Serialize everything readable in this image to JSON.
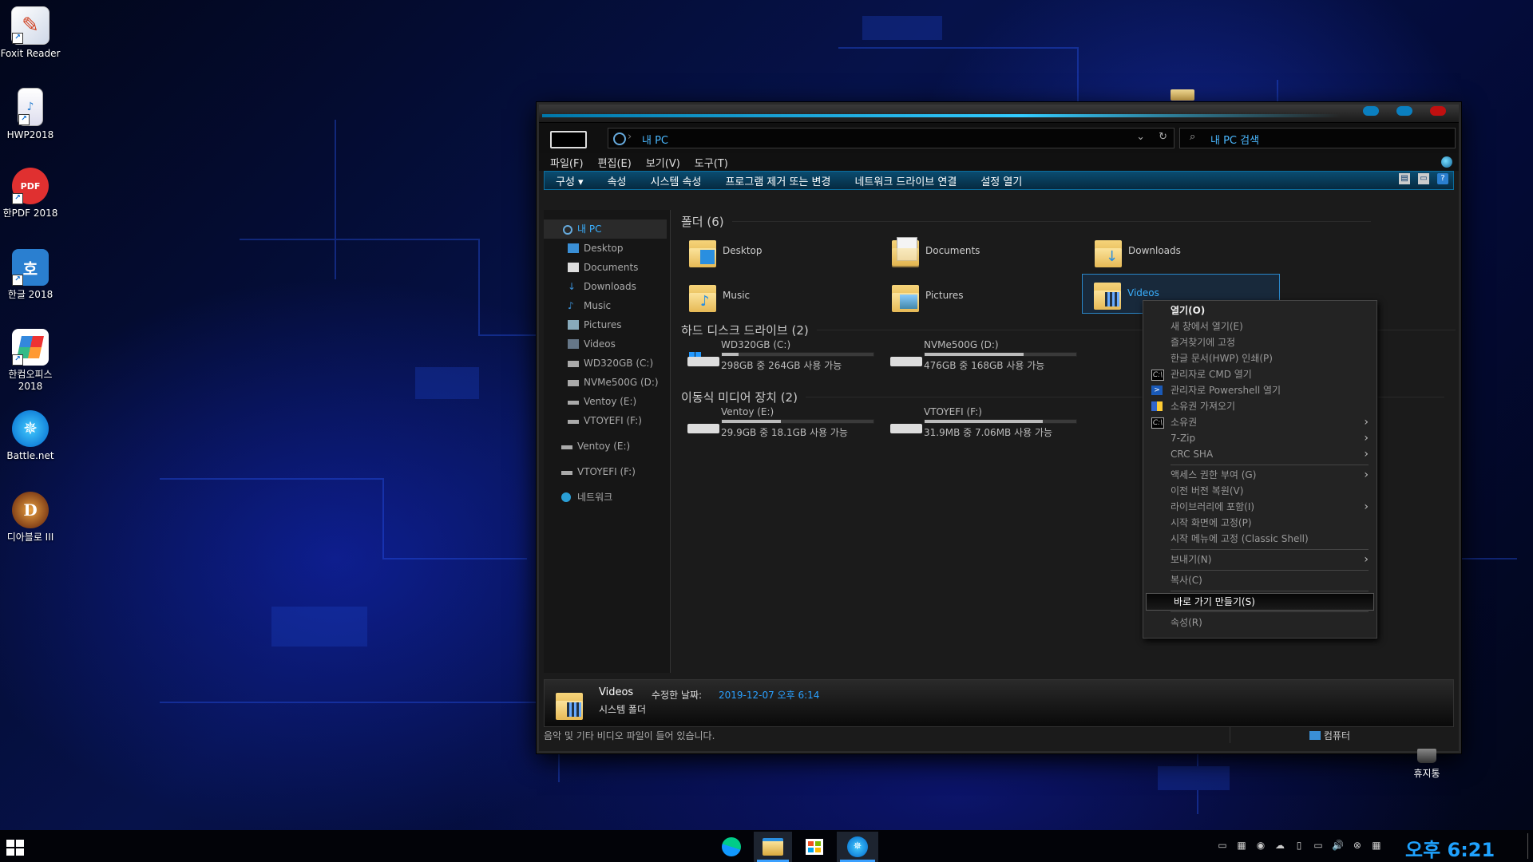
{
  "desktop": {
    "icons": [
      {
        "label": "Foxit Reader",
        "icon": "foxit-reader-icon",
        "color": "#f0f0f0"
      },
      {
        "label": "HWP2018",
        "icon": "hwp-document-icon",
        "color": "#5aa0e0"
      },
      {
        "label": "한PDF 2018",
        "icon": "hanpdf-icon",
        "color": "#e03030"
      },
      {
        "label": "한글 2018",
        "icon": "hangul-icon",
        "color": "#2a7fd0"
      },
      {
        "label": "한컴오피스 2018",
        "icon": "hancom-office-icon",
        "color": "#ffffff"
      },
      {
        "label": "Battle.net",
        "icon": "battlenet-icon",
        "color": "#1a8fff"
      },
      {
        "label": "디아블로 III",
        "icon": "diablo-icon",
        "color": "#7a2a10"
      }
    ],
    "icon_glyphs": {
      "hangul": "호",
      "pdf": "PDF",
      "diablo": "D"
    },
    "recycle_bin": "휴지통"
  },
  "explorer": {
    "address": {
      "label": "내 PC",
      "separator": "›",
      "dropdown": "⌄",
      "refresh": "↻"
    },
    "search_placeholder": "내 PC 검색",
    "menu": [
      "파일(F)",
      "편집(E)",
      "보기(V)",
      "도구(T)"
    ],
    "commands": [
      "구성 ▾",
      "속성",
      "시스템 속성",
      "프로그램 제거 또는 변경",
      "네트워크 드라이브 연결",
      "설정 열기"
    ],
    "nav": {
      "root": "내 PC",
      "children": [
        "Desktop",
        "Documents",
        "Downloads",
        "Music",
        "Pictures",
        "Videos",
        "WD320GB (C:)",
        "NVMe500G (D:)",
        "Ventoy (E:)",
        "VTOYEFI (F:)"
      ],
      "extra": [
        "Ventoy (E:)",
        "VTOYEFI (F:)",
        "네트워크"
      ]
    },
    "groups": {
      "folders": "폴더 (6)",
      "hdd": "하드 디스크 드라이브 (2)",
      "removable": "이동식 미디어 장치 (2)"
    },
    "folders": [
      "Desktop",
      "Documents",
      "Downloads",
      "Music",
      "Pictures",
      "Videos"
    ],
    "drives": [
      {
        "name": "WD320GB (C:)",
        "free": "298GB 중 264GB 사용 가능",
        "used_fraction": 0.11
      },
      {
        "name": "NVMe500G (D:)",
        "free": "476GB 중 168GB 사용 가능",
        "used_fraction": 0.65
      },
      {
        "name": "Ventoy (E:)",
        "free": "29.9GB 중 18.1GB 사용 가능",
        "used_fraction": 0.39
      },
      {
        "name": "VTOYEFI (F:)",
        "free": "31.9MB 중 7.06MB 사용 가능",
        "used_fraction": 0.78
      }
    ],
    "details": {
      "name": "Videos",
      "type": "시스템 폴더",
      "modified_label": "수정한 날짜:",
      "modified_value": "2019-12-07 오후 6:14"
    },
    "status": {
      "message": "음악 및 기타 비디오 파일이 들어 있습니다.",
      "location": "컴퓨터"
    }
  },
  "context_menu": {
    "items": [
      {
        "label": "열기(O)",
        "bold": true
      },
      {
        "label": "새 창에서 열기(E)"
      },
      {
        "label": "즐겨찾기에 고정"
      },
      {
        "label": "한글 문서(HWP) 인쇄(P)"
      },
      {
        "label": "관리자로 CMD 열기",
        "icon": "cmd-icon"
      },
      {
        "label": "관리자로 Powershell 열기",
        "icon": "powershell-icon"
      },
      {
        "label": "소유권 가져오기",
        "icon": "shield-icon"
      },
      {
        "label": "소유권",
        "icon": "cmd-icon",
        "submenu": true
      },
      {
        "label": "7-Zip",
        "submenu": true
      },
      {
        "label": "CRC SHA",
        "submenu": true
      },
      {
        "label": "액세스 권한 부여 (G)",
        "submenu": true
      },
      {
        "label": "이전 버전 복원(V)"
      },
      {
        "label": "라이브러리에 포함(I)",
        "submenu": true
      },
      {
        "label": "시작 화면에 고정(P)"
      },
      {
        "label": "시작 메뉴에 고정 (Classic Shell)"
      },
      {
        "label": "보내기(N)",
        "submenu": true
      },
      {
        "label": "복사(C)"
      },
      {
        "label": "바로 가기 만들기(S)",
        "highlighted": true
      },
      {
        "label": "속성(R)"
      }
    ],
    "arrow": "›"
  },
  "taskbar": {
    "apps": [
      "edge-icon",
      "file-explorer-icon",
      "store-icon",
      "battlenet-icon"
    ],
    "active_app": "file-explorer-icon",
    "tray": [
      "▭",
      "▦",
      "◉",
      "☁",
      "▯",
      "▭",
      "🔊",
      "⊗",
      "▦"
    ],
    "clock": "오후 6:21"
  },
  "colors": {
    "accent": "#1fa2ff",
    "selection": "#2a86c8",
    "command_bar": "#0a4c70"
  }
}
